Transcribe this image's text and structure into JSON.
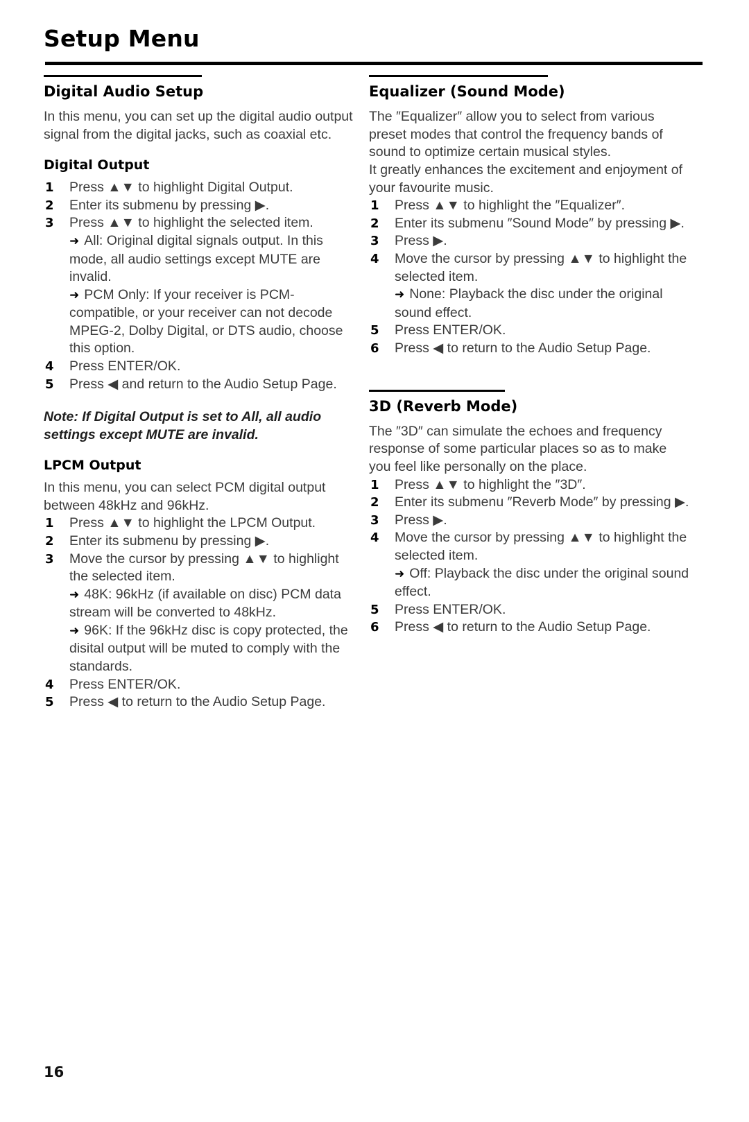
{
  "page": {
    "title": "Setup Menu",
    "number": "16"
  },
  "glyphs": {
    "up_down": "▲▼",
    "right": "▶",
    "left": "◀",
    "bullet_arrow": "➜"
  },
  "left_column": {
    "section": {
      "heading": "Digital Audio Setup",
      "intro": "In this menu, you can set up the digital audio output signal from the digital jacks, such as coaxial etc."
    },
    "digital_output": {
      "heading": "Digital Output",
      "steps": [
        {
          "num": "1",
          "text": "Press ▲▼ to highlight Digital Output."
        },
        {
          "num": "2",
          "text": "Enter its submenu by pressing ▶."
        },
        {
          "num": "3",
          "text": "Press ▲▼ to highlight the selected item."
        }
      ],
      "bullets": [
        "All: Original digital signals output. In this mode, all audio settings except MUTE are invalid.",
        "PCM Only: If your receiver is PCM-compatible, or your receiver can not decode MPEG-2, Dolby Digital, or DTS audio, choose this option."
      ],
      "steps_cont": [
        {
          "num": "4",
          "text": "Press ENTER/OK."
        },
        {
          "num": "5",
          "text": "Press ◀ and return to the Audio Setup Page."
        }
      ],
      "note": "Note: If Digital Output is set to All, all audio settings except MUTE are invalid."
    },
    "lpcm_output": {
      "heading": "LPCM Output",
      "intro": "In this menu, you can select PCM digital output between 48kHz and 96kHz.",
      "steps": [
        {
          "num": "1",
          "text": "Press ▲▼ to highlight the LPCM Output."
        },
        {
          "num": "2",
          "text": "Enter its submenu by pressing ▶."
        },
        {
          "num": "3",
          "text": "Move the cursor by pressing ▲▼ to highlight the selected item."
        }
      ],
      "bullets": [
        "48K: 96kHz (if available on disc) PCM data stream will be converted to 48kHz.",
        "96K: If the 96kHz disc is copy protected, the disital output will be muted to comply with the standards."
      ],
      "steps_cont": [
        {
          "num": "4",
          "text": "Press ENTER/OK."
        },
        {
          "num": "5",
          "text": "Press ◀ to return to the Audio Setup Page."
        }
      ]
    }
  },
  "right_column": {
    "equalizer": {
      "heading": "Equalizer (Sound Mode)",
      "intro_1": "The ″Equalizer″ allow you to select from various preset modes that control the frequency bands of sound to optimize certain musical styles.",
      "intro_2": "It greatly enhances the excitement and enjoyment of your favourite music.",
      "steps": [
        {
          "num": "1",
          "text": "Press ▲▼ to highlight the ″Equalizer″."
        },
        {
          "num": "2",
          "text": "Enter its submenu ″Sound Mode″ by pressing ▶."
        },
        {
          "num": "3",
          "text": "Press ▶."
        },
        {
          "num": "4",
          "text": "Move the cursor by pressing ▲▼ to highlight the selected item."
        }
      ],
      "bullets": [
        "None: Playback the disc under the original sound effect."
      ],
      "steps_cont": [
        {
          "num": "5",
          "text": "Press ENTER/OK."
        },
        {
          "num": "6",
          "text": "Press ◀ to return to the Audio Setup Page."
        }
      ]
    },
    "reverb": {
      "heading": "3D (Reverb Mode)",
      "intro": "The ″3D″ can simulate the echoes and frequency response of some particular places so as to make you feel like personally on the place.",
      "steps": [
        {
          "num": "1",
          "text": "Press ▲▼ to highlight the ″3D″."
        },
        {
          "num": "2",
          "text": "Enter its submenu ″Reverb Mode″ by pressing ▶."
        },
        {
          "num": "3",
          "text": "Press ▶."
        },
        {
          "num": "4",
          "text": "Move the cursor by pressing ▲▼ to highlight the selected item."
        }
      ],
      "bullets": [
        "Off: Playback the disc under the original sound effect."
      ],
      "steps_cont": [
        {
          "num": "5",
          "text": "Press ENTER/OK."
        },
        {
          "num": "6",
          "text": "Press ◀ to return to the Audio Setup Page."
        }
      ]
    }
  }
}
